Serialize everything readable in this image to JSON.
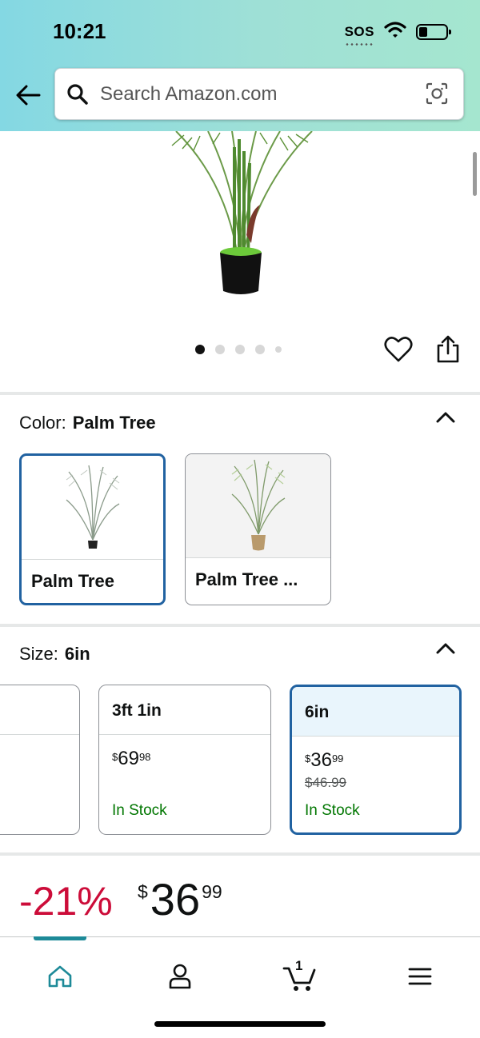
{
  "status_bar": {
    "time": "10:21",
    "sos": "SOS"
  },
  "search": {
    "placeholder": "Search Amazon.com"
  },
  "gallery": {
    "image_count": 5,
    "active_index": 0
  },
  "color": {
    "label": "Color:",
    "selected": "Palm Tree",
    "options": [
      {
        "label": "Palm Tree",
        "selected": true
      },
      {
        "label": "Palm Tree ...",
        "selected": false
      }
    ]
  },
  "size": {
    "label": "Size:",
    "selected": "6in",
    "options": [
      {
        "label": "",
        "price_dollars": "",
        "price_cents": "",
        "old_price": "",
        "stock": ""
      },
      {
        "label": "3ft 1in",
        "price_currency": "$",
        "price_dollars": "69",
        "price_cents": "98",
        "old_price": "",
        "stock": "In Stock"
      },
      {
        "label": "6in",
        "price_currency": "$",
        "price_dollars": "36",
        "price_cents": "99",
        "old_price": "$46.99",
        "stock": "In Stock",
        "selected": true
      }
    ]
  },
  "price_block": {
    "discount": "-21%",
    "currency": "$",
    "dollars": "36",
    "cents": "99"
  },
  "bottom_nav": {
    "cart_count": "1",
    "active": "home"
  },
  "colors": {
    "accent": "#2162a1",
    "discount": "#cc0c39",
    "in_stock": "#007600",
    "teal": "#1d8a98"
  }
}
